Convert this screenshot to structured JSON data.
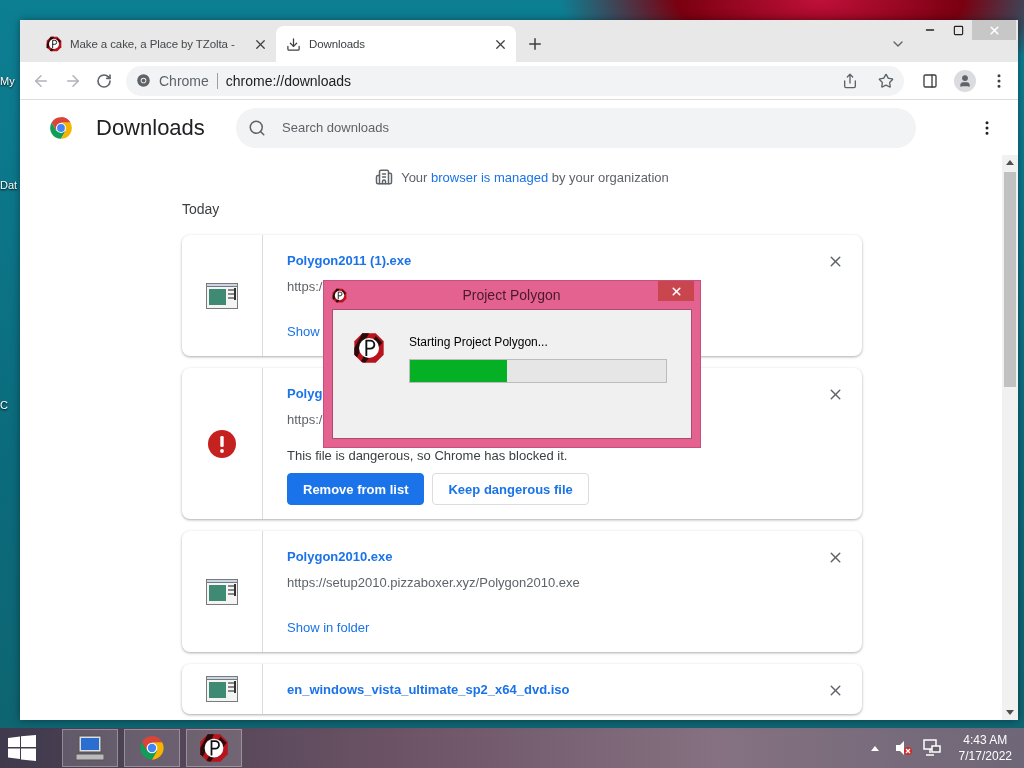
{
  "desktop_icons": [
    {
      "label": "My"
    },
    {
      "label": "Dat"
    },
    {
      "label": "C"
    }
  ],
  "browser": {
    "tabs": [
      {
        "title": "Make a cake, a Place by TZolta -",
        "selected": false
      },
      {
        "title": "Downloads",
        "selected": true
      }
    ],
    "omnibox": {
      "site_label": "Chrome",
      "url": "chrome://downloads"
    },
    "page": {
      "title": "Downloads",
      "search": {
        "placeholder": "Search downloads"
      },
      "managed_notice": {
        "before": "Your",
        "link": "browser is managed",
        "after": "by your organization"
      },
      "section": "Today",
      "downloads": [
        {
          "kind": "file",
          "name": "Polygon2011 (1).exe",
          "url": "https:/",
          "link": "Show"
        },
        {
          "kind": "dangerous",
          "name": "Polyg",
          "url": "https:/",
          "warning": "This file is dangerous, so Chrome has blocked it.",
          "buttons": [
            "Remove from list",
            "Keep dangerous file"
          ]
        },
        {
          "kind": "file",
          "name": "Polygon2010.exe",
          "url": "https://setup2010.pizzaboxer.xyz/Polygon2010.exe",
          "link": "Show in folder"
        },
        {
          "kind": "file",
          "name": "en_windows_vista_ultimate_sp2_x64_dvd.iso"
        }
      ]
    }
  },
  "dialog": {
    "title": "Project Polygon",
    "message": "Starting Project Polygon...",
    "level": 0.38
  },
  "taskbar": {
    "time": "4:43 AM",
    "date": "7/17/2022"
  }
}
